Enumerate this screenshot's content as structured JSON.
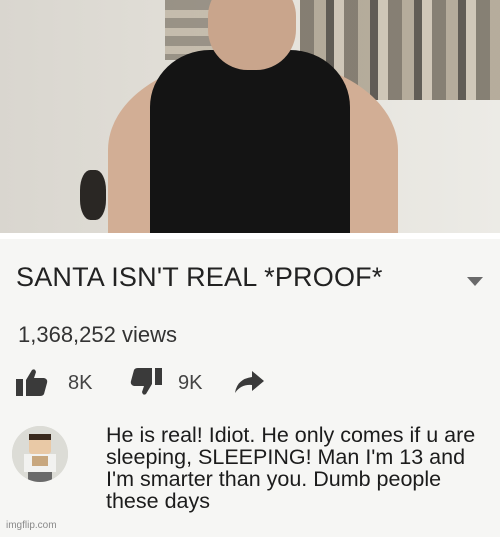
{
  "video": {
    "title": "SANTA ISN'T REAL *PROOF*",
    "views": "1,368,252 views",
    "likes": "8K",
    "dislikes": "9K"
  },
  "icons": {
    "like": "thumbs-up-icon",
    "dislike": "thumbs-down-icon",
    "share": "share-arrow-icon",
    "more": "caret-down-icon"
  },
  "comment": {
    "text": "He is real! Idiot. He only comes if u are sleeping, SLEEPING! Man I'm 13 and I'm smarter than you. Dumb people these days"
  },
  "footer": {
    "watermark": "imgflip.com"
  }
}
